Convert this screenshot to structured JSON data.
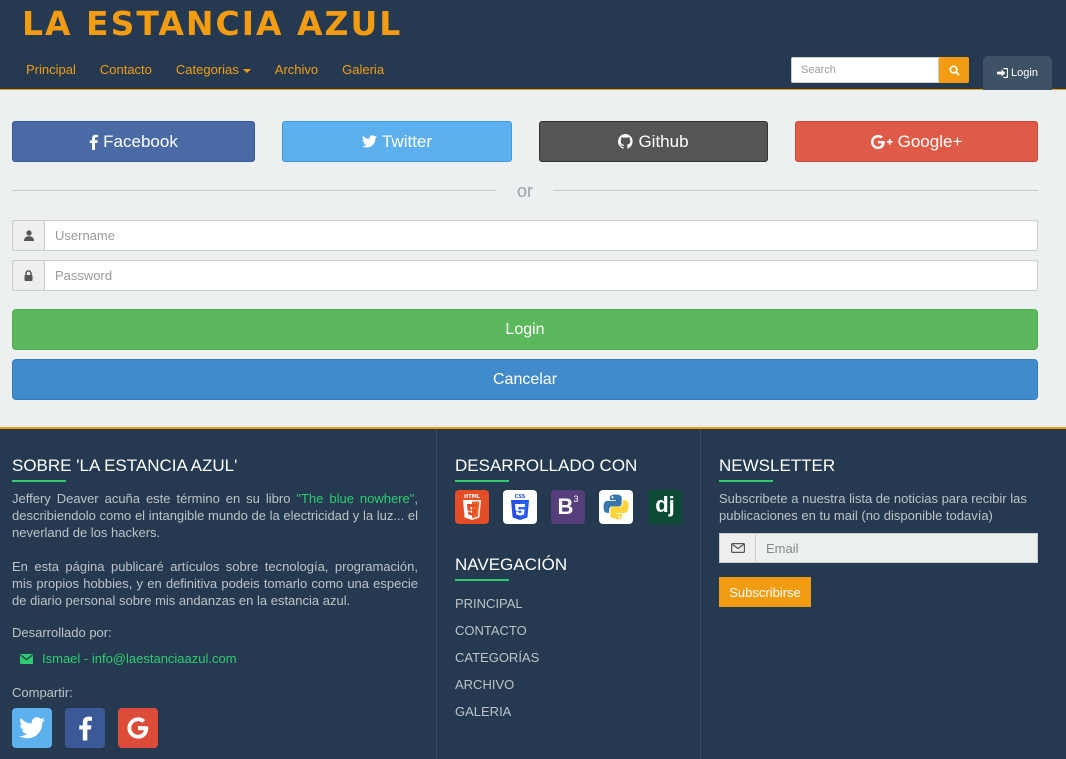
{
  "header": {
    "brand": "LA ESTANCIA AZUL",
    "nav": [
      {
        "label": "Principal"
      },
      {
        "label": "Contacto"
      },
      {
        "label": "Categorias"
      },
      {
        "label": "Archivo"
      },
      {
        "label": "Galeria"
      }
    ],
    "search_placeholder": "Search",
    "login_label": "Login"
  },
  "login_form": {
    "social": {
      "facebook": "Facebook",
      "twitter": "Twitter",
      "github": "Github",
      "google": "Google+"
    },
    "divider_text": "or",
    "username_placeholder": "Username",
    "password_placeholder": "Password",
    "login_button": "Login",
    "cancel_button": "Cancelar"
  },
  "footer": {
    "about": {
      "heading": "SOBRE 'LA ESTANCIA AZUL'",
      "p1_before": "Jeffery Deaver acuña este término en su libro ",
      "p1_link": "\"The blue nowhere\"",
      "p1_after": ", describiendolo como el intangible mundo de la electricidad y la luz... el neverland de los hackers.",
      "p2": "En esta página publicaré artículos sobre tecnología, programación, mis propios hobbies, y en definitiva podeis tomarlo como una especie de diario personal sobre mis andanzas en la estancia azul.",
      "developed_by": "Desarrollado por:",
      "contact": "Ismael - info@laestanciaazul.com",
      "share_label": "Compartir:"
    },
    "built_with": {
      "heading": "DESARROLLADO CON",
      "html5_label": "HTML",
      "css3_label": "CSS",
      "bootstrap_label": "B",
      "bootstrap_version": "3",
      "django_label": "dj"
    },
    "navigation": {
      "heading": "NAVEGACIÓN",
      "items": [
        "PRINCIPAL",
        "CONTACTO",
        "CATEGORÍAS",
        "ARCHIVO",
        "GALERIA"
      ]
    },
    "newsletter": {
      "heading": "NEWSLETTER",
      "text": "Subscribete a nuestra lista de noticias para recibir las publicaciones en tu mail (no disponible todavía)",
      "email_placeholder": "Email",
      "button": "Subscribirse"
    }
  },
  "colors": {
    "navbar": "#253a50",
    "accent": "#f39c12",
    "green": "#2ecc71",
    "facebook": "#4a6aa5",
    "twitter": "#5bb0ed",
    "github": "#555555",
    "google": "#e05a48",
    "login": "#5cb85c",
    "cancel": "#428bca"
  }
}
